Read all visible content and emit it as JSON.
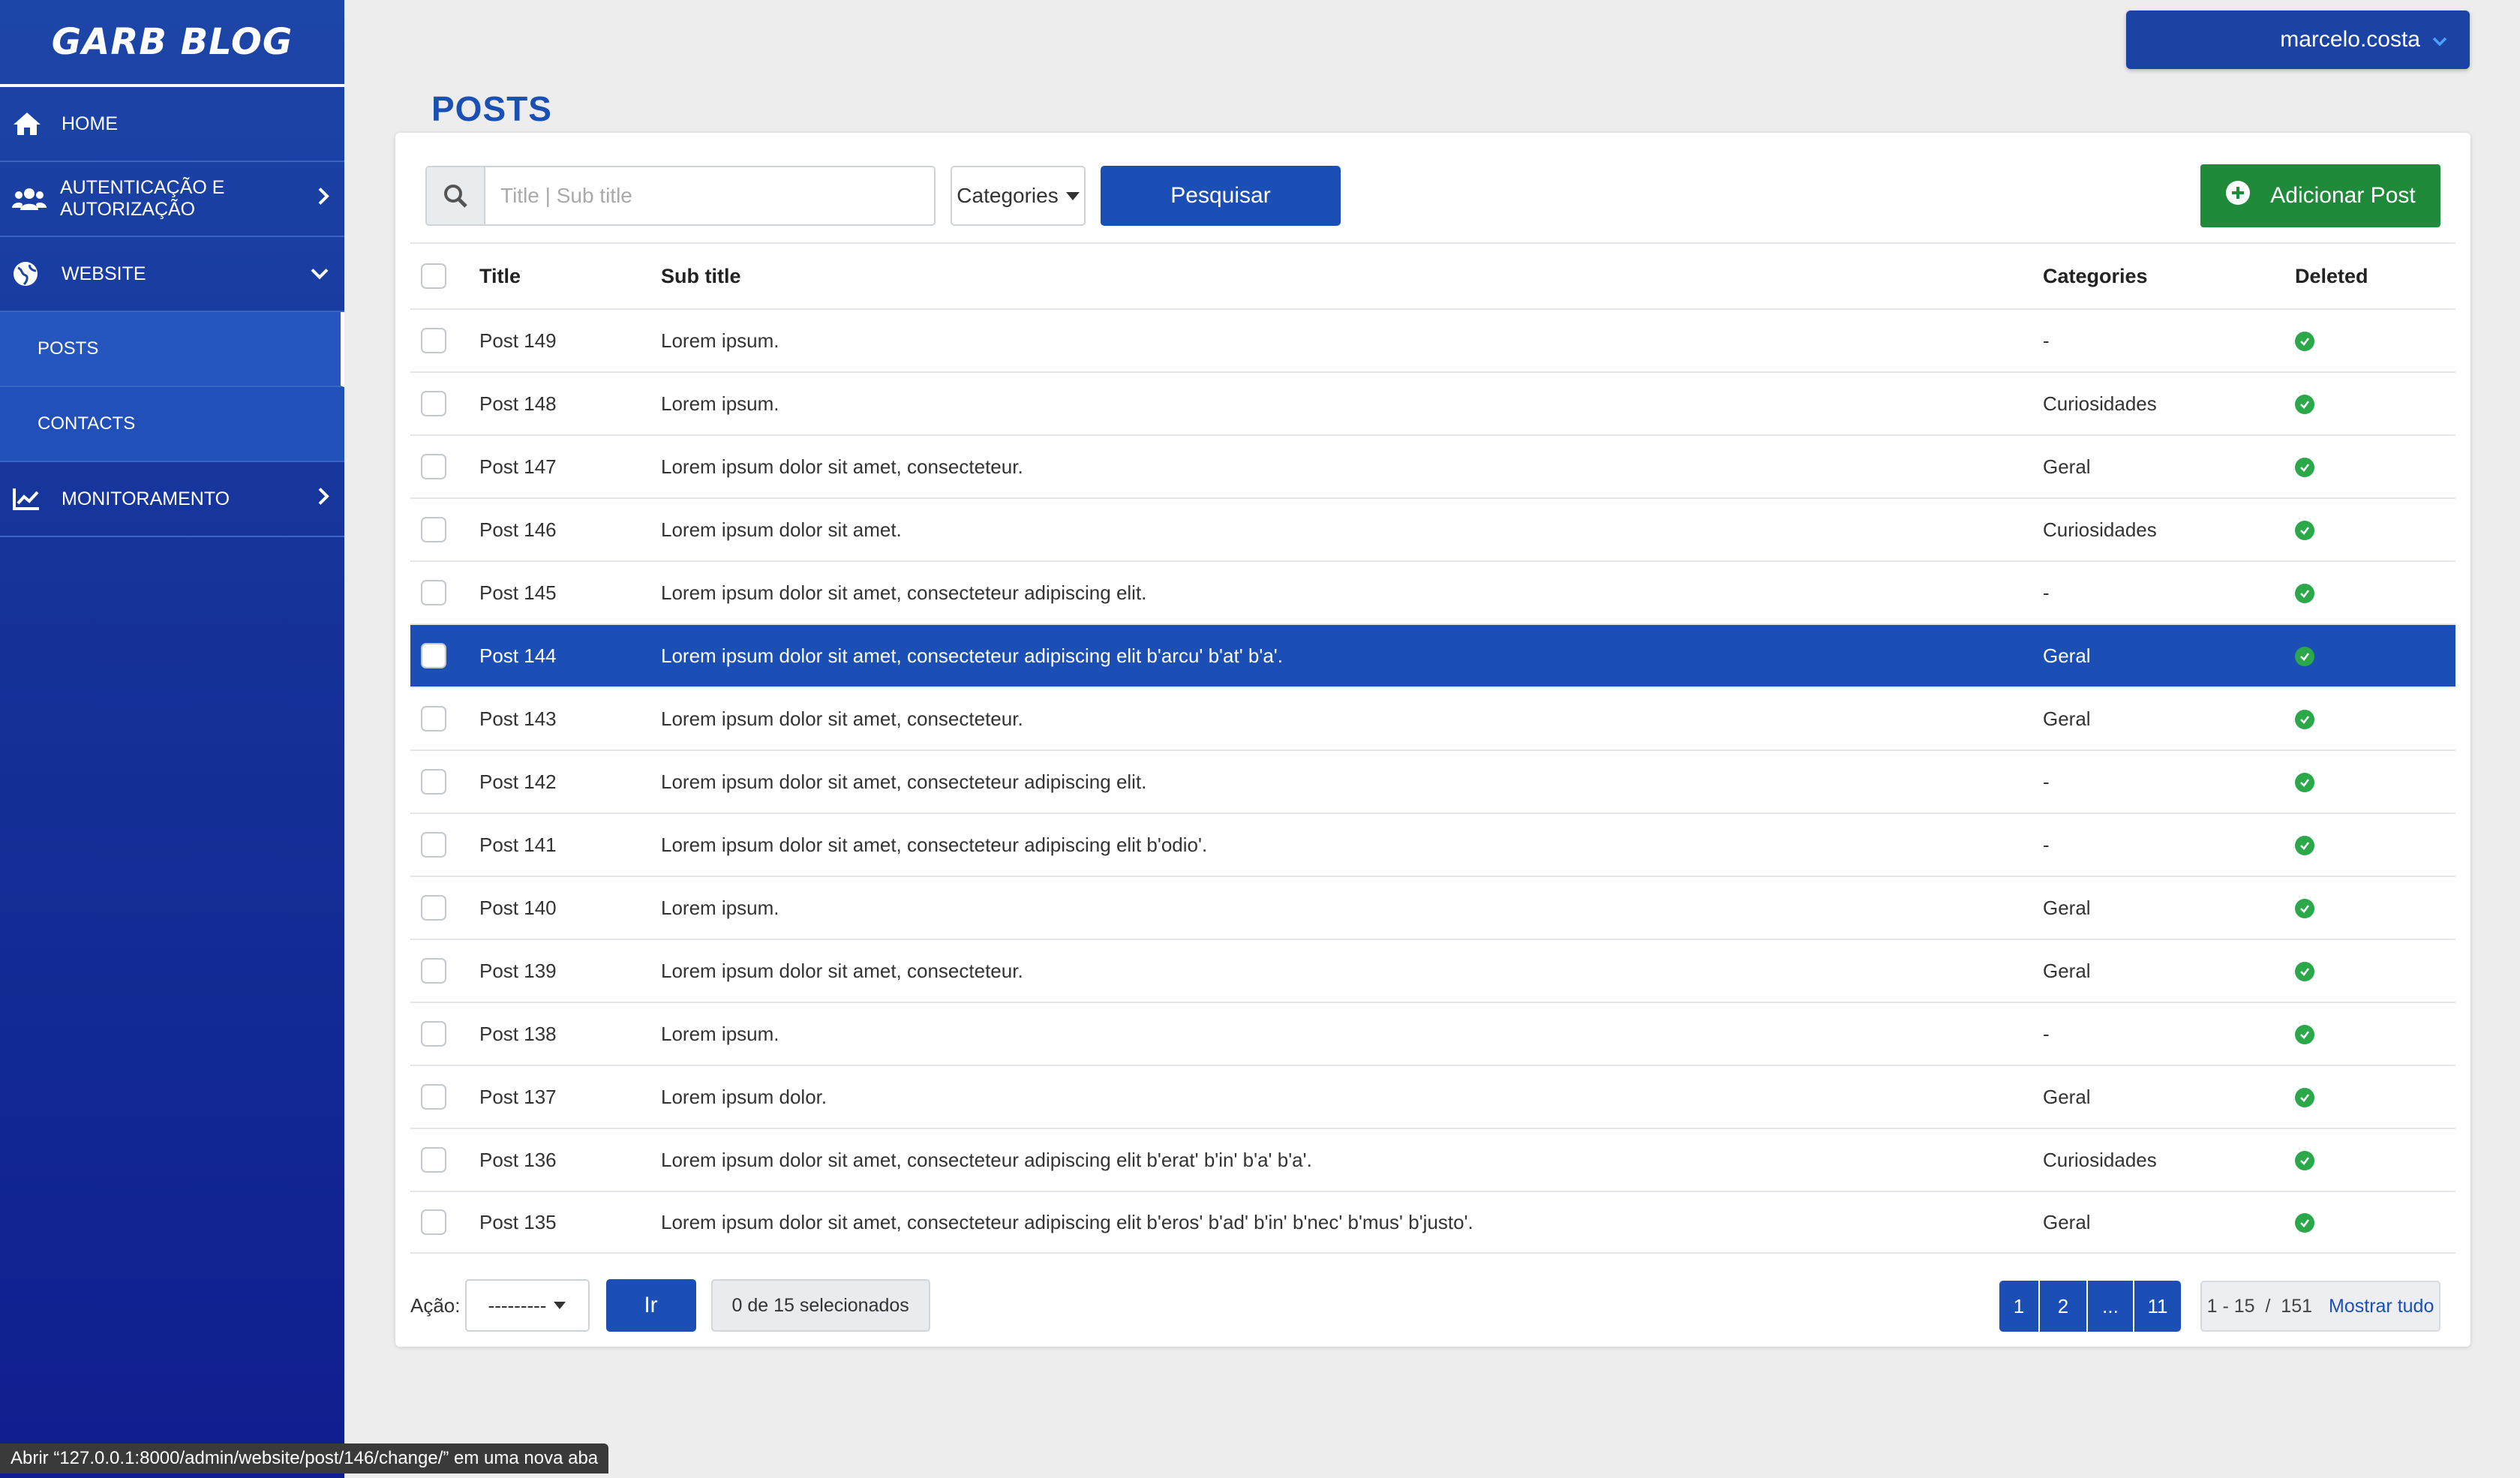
{
  "brand": "GARB BLOG",
  "user": {
    "name": "marcelo.costa"
  },
  "sidebar": {
    "items": [
      {
        "label": "HOME",
        "icon": "home-icon"
      },
      {
        "label": "AUTENTICAÇÃO E AUTORIZAÇÃO",
        "icon": "users-icon"
      },
      {
        "label": "WEBSITE",
        "icon": "globe-icon"
      },
      {
        "label": "MONITORAMENTO",
        "icon": "chart-line-icon"
      }
    ],
    "website_sub": [
      {
        "label": "POSTS"
      },
      {
        "label": "CONTACTS"
      }
    ]
  },
  "page": {
    "title": "POSTS"
  },
  "toolbar": {
    "search_placeholder": "Title | Sub title",
    "categories_label": "Categories",
    "search_button": "Pesquisar",
    "add_button": "Adicionar Post"
  },
  "table": {
    "columns": [
      "Title",
      "Sub title",
      "Categories",
      "Deleted"
    ],
    "rows": [
      {
        "title": "Post 149",
        "sub": "Lorem ipsum.",
        "cat": "-"
      },
      {
        "title": "Post 148",
        "sub": "Lorem ipsum.",
        "cat": "Curiosidades"
      },
      {
        "title": "Post 147",
        "sub": "Lorem ipsum dolor sit amet, consecteteur.",
        "cat": "Geral"
      },
      {
        "title": "Post 146",
        "sub": "Lorem ipsum dolor sit amet.",
        "cat": "Curiosidades"
      },
      {
        "title": "Post 145",
        "sub": "Lorem ipsum dolor sit amet, consecteteur adipiscing elit.",
        "cat": "-"
      },
      {
        "title": "Post 144",
        "sub": "Lorem ipsum dolor sit amet, consecteteur adipiscing elit b'arcu' b'at' b'a'.",
        "cat": "Geral"
      },
      {
        "title": "Post 143",
        "sub": "Lorem ipsum dolor sit amet, consecteteur.",
        "cat": "Geral"
      },
      {
        "title": "Post 142",
        "sub": "Lorem ipsum dolor sit amet, consecteteur adipiscing elit.",
        "cat": "-"
      },
      {
        "title": "Post 141",
        "sub": "Lorem ipsum dolor sit amet, consecteteur adipiscing elit b'odio'.",
        "cat": "-"
      },
      {
        "title": "Post 140",
        "sub": "Lorem ipsum.",
        "cat": "Geral"
      },
      {
        "title": "Post 139",
        "sub": "Lorem ipsum dolor sit amet, consecteteur.",
        "cat": "Geral"
      },
      {
        "title": "Post 138",
        "sub": "Lorem ipsum.",
        "cat": "-"
      },
      {
        "title": "Post 137",
        "sub": "Lorem ipsum dolor.",
        "cat": "Geral"
      },
      {
        "title": "Post 136",
        "sub": "Lorem ipsum dolor sit amet, consecteteur adipiscing elit b'erat' b'in' b'a' b'a'.",
        "cat": "Curiosidades"
      },
      {
        "title": "Post 135",
        "sub": "Lorem ipsum dolor sit amet, consecteteur adipiscing elit b'eros' b'ad' b'in' b'nec' b'mus' b'justo'.",
        "cat": "Geral"
      }
    ],
    "highlighted_row": "Post 144"
  },
  "footer": {
    "action_label": "Ação:",
    "action_select": "---------",
    "go_button": "Ir",
    "selected_count": "0 de 15 selecionados",
    "pages": [
      "1",
      "2",
      "...",
      "11"
    ],
    "range": "1 - 15  /  151",
    "show_all": "Mostrar tudo"
  },
  "status_bar": "Abrir “127.0.0.1:8000/admin/website/post/146/change/” em uma nova aba",
  "colors": {
    "primary": "#1c4fb5",
    "success": "#1f8a3a",
    "deleted_ok": "#2aa84a"
  }
}
